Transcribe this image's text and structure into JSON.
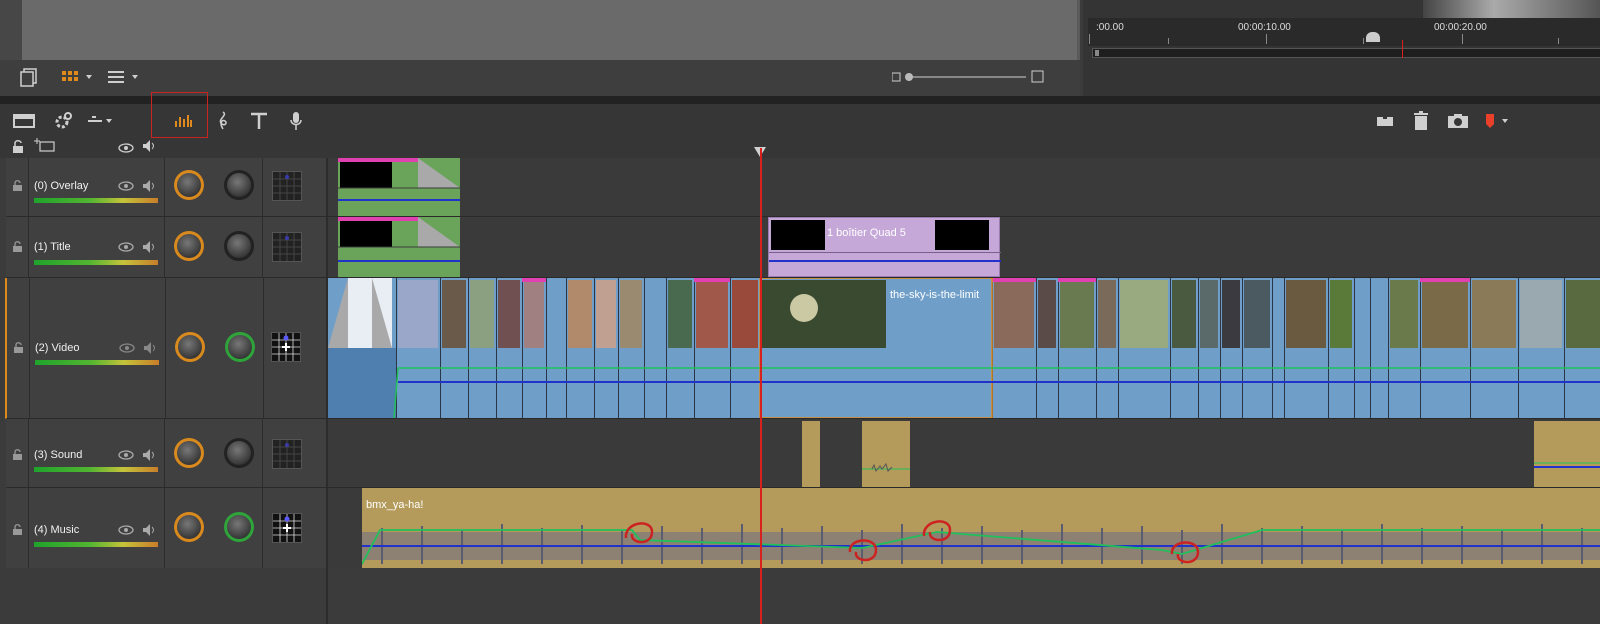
{
  "ruler": {
    "tc1": ":00.00",
    "tc2": "00:00:10.00",
    "tc3": "00:00:20.00"
  },
  "toolbar_icons": [
    "library-icon",
    "grid-view-icon",
    "list-view-icon",
    "mixer-icon",
    "music-clef-icon",
    "title-icon",
    "microphone-icon",
    "trim-icon",
    "trash-icon",
    "snapshot-icon",
    "marker-icon"
  ],
  "tracks": [
    {
      "name": "(0) Overlay"
    },
    {
      "name": "(1) Title"
    },
    {
      "name": "(2) Video"
    },
    {
      "name": "(3) Sound"
    },
    {
      "name": "(4) Music"
    }
  ],
  "clips": {
    "title_clip": "1 boîtier Quad 5",
    "video_clip": "the-sky-is-the-limit",
    "music_clip": "bmx_ya-ha!"
  },
  "colors": {
    "accent_orange": "#e08a1c",
    "playhead": "#d8201c",
    "video_clip": "#6f9fc8",
    "music_clip": "#b49b5b",
    "title_clip": "#c5a7d8",
    "overlay_clip": "#6aa35a",
    "highlight_box": "#cc2222"
  }
}
